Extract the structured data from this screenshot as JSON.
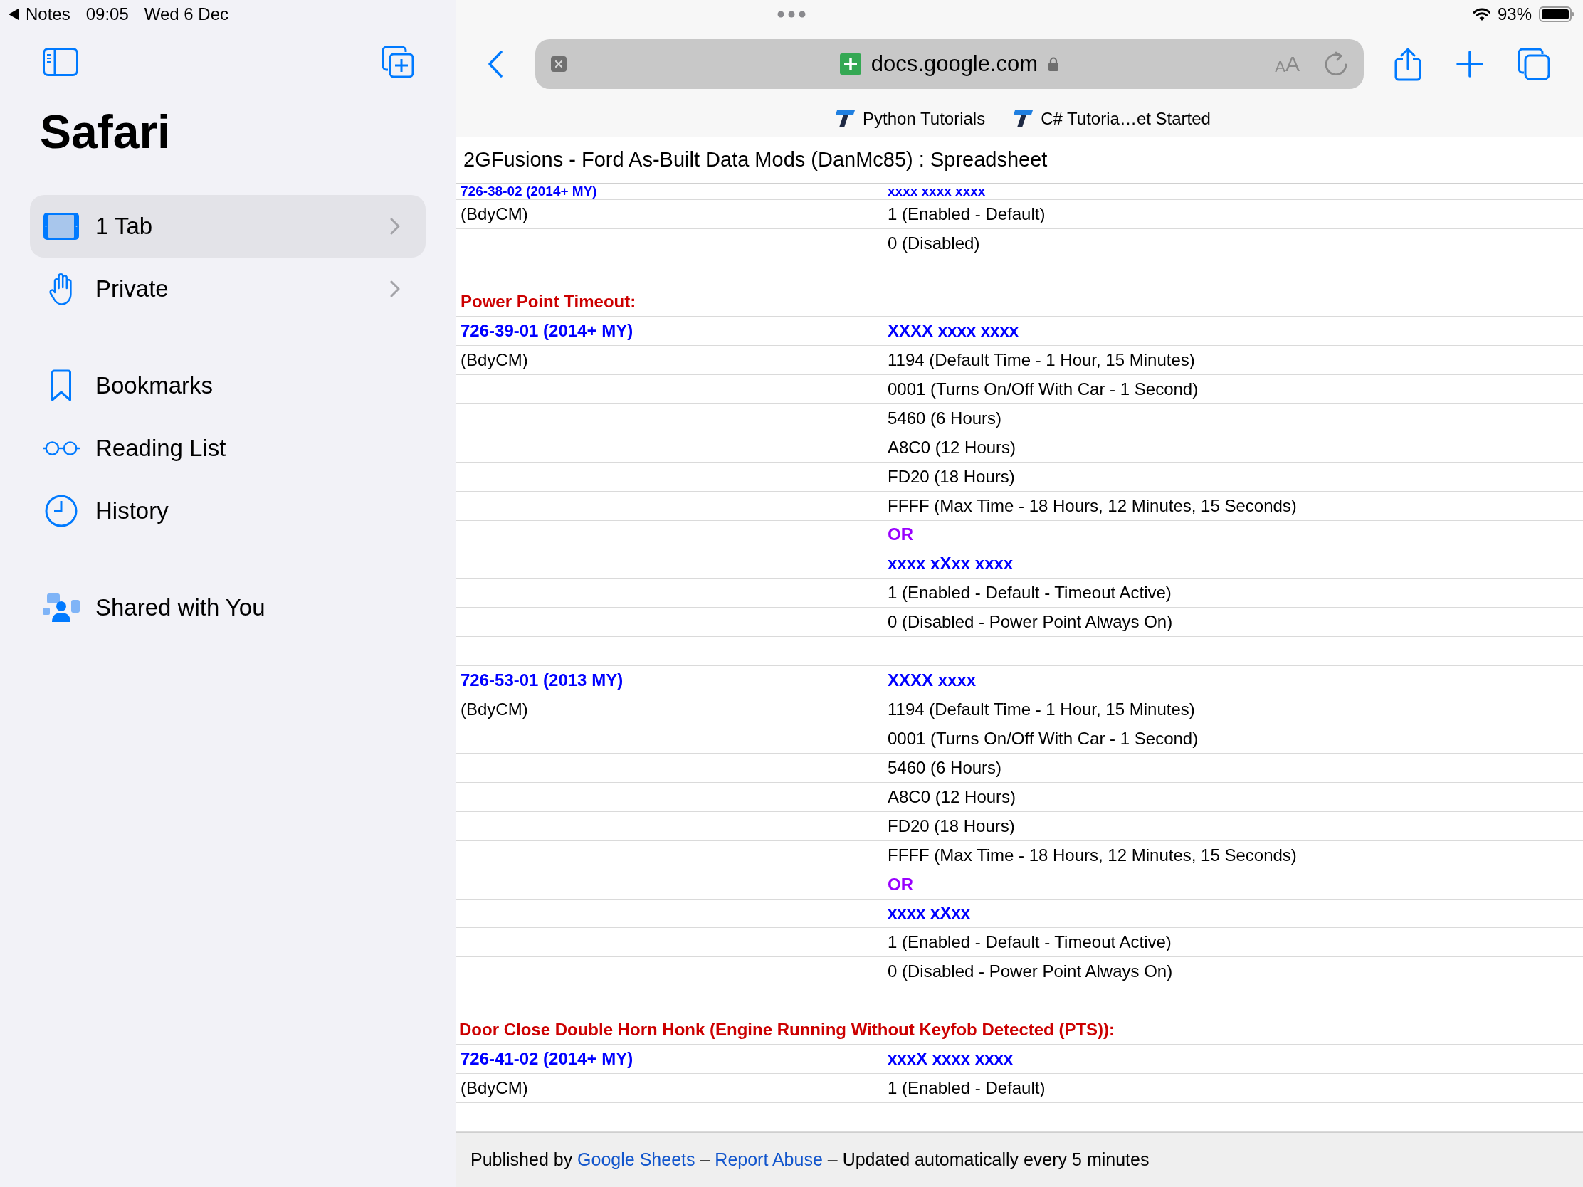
{
  "status_bar": {
    "back_app": "Notes",
    "time": "09:05",
    "date": "Wed 6 Dec",
    "battery": "93%"
  },
  "sidebar": {
    "title": "Safari",
    "groups": [
      {
        "items": [
          {
            "label": "1 Tab",
            "kind": "tab_group",
            "selected": true
          },
          {
            "label": "Private",
            "kind": "tab_group",
            "selected": false
          }
        ]
      },
      {
        "items": [
          {
            "label": "Bookmarks",
            "kind": "link",
            "selected": false
          },
          {
            "label": "Reading List",
            "kind": "link",
            "selected": false
          },
          {
            "label": "History",
            "kind": "link",
            "selected": false
          }
        ]
      },
      {
        "items": [
          {
            "label": "Shared with You",
            "kind": "link",
            "selected": false
          }
        ]
      }
    ]
  },
  "toolbar": {
    "address": "docs.google.com",
    "text_size_button": "AA"
  },
  "favorites_bar": [
    {
      "label": "Python Tutorials"
    },
    {
      "label": "C# Tutoria…et Started"
    }
  ],
  "page": {
    "title": "2GFusions - Ford As-Built Data Mods (DanMc85) : Spreadsheet",
    "rows": [
      {
        "kind": "partial",
        "column_1": {
          "text": "726-38-02 (2014+ MY)",
          "kind": "code"
        },
        "column_2": {
          "text": "xxxx xxxx xxxx",
          "kind": "code"
        }
      },
      {
        "kind": "pair",
        "column_1": {
          "text": "(BdyCM)",
          "kind": "plain"
        },
        "column_2": {
          "text": "1 (Enabled - Default)",
          "kind": "plain"
        }
      },
      {
        "kind": "pair",
        "column_2": {
          "text": "0 (Disabled)",
          "kind": "plain"
        }
      },
      {
        "kind": "pair"
      },
      {
        "kind": "pair",
        "column_1": {
          "text": "Power Point Timeout:",
          "kind": "heading"
        }
      },
      {
        "kind": "pair",
        "column_1": {
          "text": "726-39-01 (2014+ MY)",
          "kind": "code"
        },
        "column_2": {
          "text": "XXXX xxxx xxxx",
          "kind": "code"
        }
      },
      {
        "kind": "pair",
        "column_1": {
          "text": "(BdyCM)",
          "kind": "plain"
        },
        "column_2": {
          "text": "1194 (Default Time - 1 Hour, 15 Minutes)",
          "kind": "plain"
        }
      },
      {
        "kind": "pair",
        "column_2": {
          "text": "0001 (Turns On/Off With Car - 1 Second)",
          "kind": "plain"
        }
      },
      {
        "kind": "pair",
        "column_2": {
          "text": "5460 (6 Hours)",
          "kind": "plain"
        }
      },
      {
        "kind": "pair",
        "column_2": {
          "text": "A8C0 (12 Hours)",
          "kind": "plain"
        }
      },
      {
        "kind": "pair",
        "column_2": {
          "text": "FD20 (18 Hours)",
          "kind": "plain"
        }
      },
      {
        "kind": "pair",
        "column_2": {
          "text": "FFFF (Max Time - 18 Hours, 12 Minutes, 15 Seconds)",
          "kind": "plain"
        }
      },
      {
        "kind": "pair",
        "column_2": {
          "text": "OR",
          "kind": "or"
        }
      },
      {
        "kind": "pair",
        "column_2": {
          "text": "xxxx xXxx xxxx",
          "kind": "code"
        }
      },
      {
        "kind": "pair",
        "column_2": {
          "text": "1 (Enabled - Default - Timeout Active)",
          "kind": "plain"
        }
      },
      {
        "kind": "pair",
        "column_2": {
          "text": "0 (Disabled - Power Point Always On)",
          "kind": "plain"
        }
      },
      {
        "kind": "pair"
      },
      {
        "kind": "pair",
        "column_1": {
          "text": "726-53-01 (2013 MY)",
          "kind": "code"
        },
        "column_2": {
          "text": "XXXX xxxx",
          "kind": "code"
        }
      },
      {
        "kind": "pair",
        "column_1": {
          "text": "(BdyCM)",
          "kind": "plain"
        },
        "column_2": {
          "text": "1194 (Default Time - 1 Hour, 15 Minutes)",
          "kind": "plain"
        }
      },
      {
        "kind": "pair",
        "column_2": {
          "text": "0001 (Turns On/Off With Car - 1 Second)",
          "kind": "plain"
        }
      },
      {
        "kind": "pair",
        "column_2": {
          "text": "5460 (6 Hours)",
          "kind": "plain"
        }
      },
      {
        "kind": "pair",
        "column_2": {
          "text": "A8C0 (12 Hours)",
          "kind": "plain"
        }
      },
      {
        "kind": "pair",
        "column_2": {
          "text": "FD20 (18 Hours)",
          "kind": "plain"
        }
      },
      {
        "kind": "pair",
        "column_2": {
          "text": "FFFF (Max Time - 18 Hours, 12 Minutes, 15 Seconds)",
          "kind": "plain"
        }
      },
      {
        "kind": "pair",
        "column_2": {
          "text": "OR",
          "kind": "or"
        }
      },
      {
        "kind": "pair",
        "column_2": {
          "text": "xxxx xXxx",
          "kind": "code"
        }
      },
      {
        "kind": "pair",
        "column_2": {
          "text": "1 (Enabled - Default - Timeout Active)",
          "kind": "plain"
        }
      },
      {
        "kind": "pair",
        "column_2": {
          "text": "0 (Disabled - Power Point Always On)",
          "kind": "plain"
        }
      },
      {
        "kind": "pair"
      },
      {
        "kind": "merged",
        "column_1": {
          "text": "Door Close Double Horn Honk (Engine Running Without Keyfob Detected (PTS)):",
          "kind": "heading"
        }
      },
      {
        "kind": "pair",
        "column_1": {
          "text": "726-41-02 (2014+ MY)",
          "kind": "code"
        },
        "column_2": {
          "text": "xxxX xxxx xxxx",
          "kind": "code"
        }
      },
      {
        "kind": "pair",
        "column_1": {
          "text": "(BdyCM)",
          "kind": "plain"
        },
        "column_2": {
          "text": "1 (Enabled - Default)",
          "kind": "plain"
        }
      },
      {
        "kind": "pair"
      }
    ]
  },
  "footer": [
    {
      "kind": "text",
      "text": "Published by"
    },
    {
      "kind": "link",
      "text": "Google Sheets"
    },
    {
      "kind": "text",
      "text": "–"
    },
    {
      "kind": "link",
      "text": "Report Abuse"
    },
    {
      "kind": "text",
      "text": "–"
    },
    {
      "kind": "text",
      "text": "Updated automatically every 5 minutes"
    }
  ]
}
